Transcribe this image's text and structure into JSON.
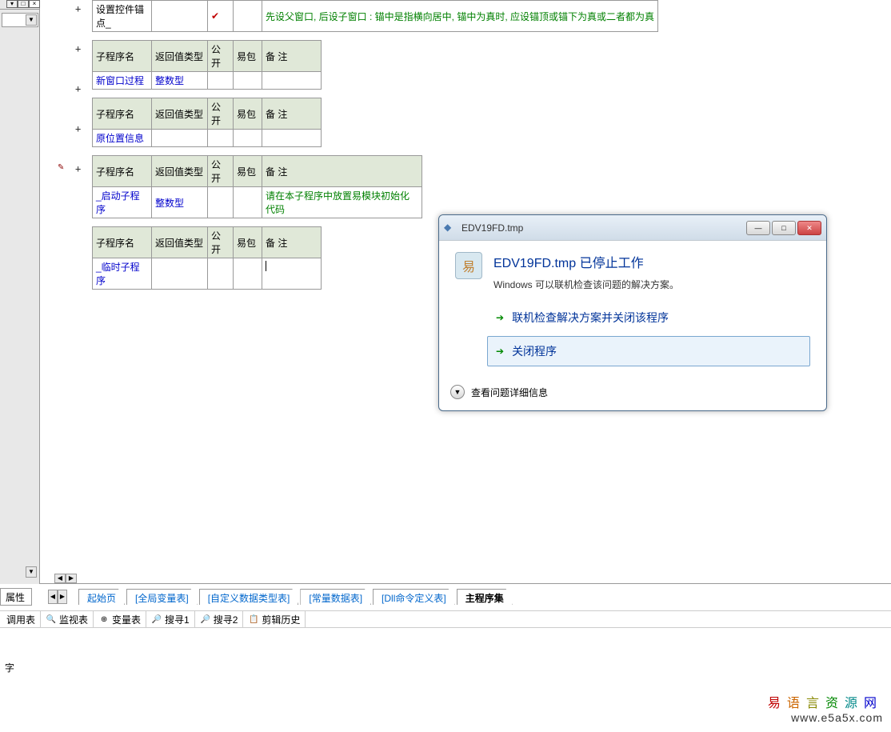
{
  "left_panel": {
    "prop_tab": "属性"
  },
  "headers": {
    "name": "子程序名",
    "ret": "返回值类型",
    "pub": "公开",
    "pkg": "易包",
    "note": "备 注"
  },
  "row_anchor": {
    "name": "设置控件锚点_",
    "note": "先设父窗口, 后设子窗口 : 锚中是指横向居中, 锚中为真时, 应设锚顶或锚下为真或二者都为真"
  },
  "row_newwin": {
    "name": "新窗口过程",
    "ret": "整数型"
  },
  "row_origpos": {
    "name": "原位置信息"
  },
  "row_startup": {
    "name": "_启动子程序",
    "ret": "整数型",
    "note": "请在本子程序中放置易模块初始化代码"
  },
  "row_temp": {
    "name": "_临时子程序"
  },
  "tabs": [
    "起始页",
    "[全局变量表]",
    "[自定义数据类型表]",
    "[常量数据表]",
    "[Dll命令定义表]",
    "主程序集"
  ],
  "tools": {
    "call": "调用表",
    "watch": "监视表",
    "var": "变量表",
    "search1": "搜寻1",
    "search2": "搜寻2",
    "edit_hist": "剪辑历史"
  },
  "status_char": "字",
  "dialog": {
    "title": "EDV19FD.tmp",
    "heading": "EDV19FD.tmp 已停止工作",
    "subtext": "Windows 可以联机检查该问题的解决方案。",
    "action1": "联机检查解决方案并关闭该程序",
    "action2": "关闭程序",
    "details": "查看问题详细信息"
  },
  "watermark": {
    "text": "易语言资源网",
    "url": "www.e5a5x.com"
  }
}
